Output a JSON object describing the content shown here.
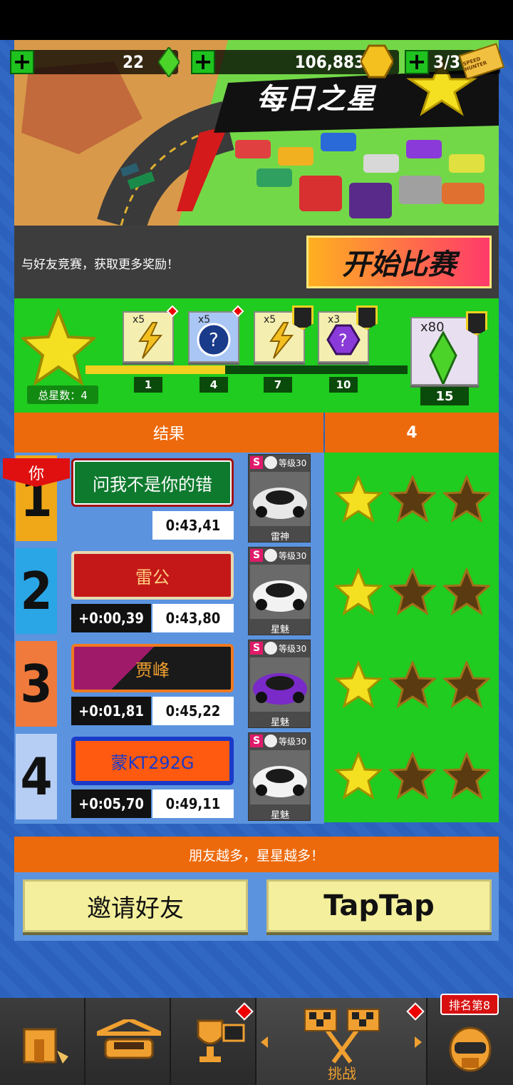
{
  "hud": {
    "gems": "22",
    "coins": "106,883",
    "tickets": "3/3",
    "ticket_badge": "SPEED HUNTER"
  },
  "banner": {
    "title": "每日之星"
  },
  "invite_strip": {
    "text": "与好友竞赛，获取更多奖励！",
    "start_button": "开始比赛"
  },
  "progress": {
    "total_stars_label": "总星数：4",
    "current_stars": 4,
    "rewards": [
      {
        "qty": "x5",
        "item": "lightning-icon",
        "milestone": "1",
        "locked": false,
        "new": true
      },
      {
        "qty": "x5",
        "item": "mystery-token-icon",
        "milestone": "4",
        "locked": false,
        "new": true
      },
      {
        "qty": "x5",
        "item": "lightning-icon",
        "milestone": "7",
        "locked": true,
        "new": false
      },
      {
        "qty": "x3",
        "item": "mystery-gem-icon",
        "milestone": "10",
        "locked": true,
        "new": false
      },
      {
        "qty": "x80",
        "item": "green-gem-icon",
        "milestone": "15",
        "locked": true,
        "new": false
      }
    ]
  },
  "results": {
    "header": "结果",
    "stars_header": "4",
    "you_tag": "你",
    "rows": [
      {
        "rank": "1",
        "name": "问我不是你的错",
        "diff": "",
        "time": "0:43,41",
        "car": "雷神",
        "level": "等级30",
        "stars": 1,
        "rank_color": "#f0a818",
        "plate": "green"
      },
      {
        "rank": "2",
        "name": "雷公",
        "diff": "+0:00,39",
        "time": "0:43,80",
        "car": "星魅",
        "level": "等级30",
        "stars": 1,
        "rank_color": "#2aa6e6",
        "plate": "red"
      },
      {
        "rank": "3",
        "name": "贾峰",
        "diff": "+0:01,81",
        "time": "0:45,22",
        "car": "星魅",
        "level": "等级30",
        "stars": 1,
        "rank_color": "#f07a3c",
        "plate": "dark"
      },
      {
        "rank": "4",
        "name": "蒙KT292G",
        "diff": "+0:05,70",
        "time": "0:49,11",
        "car": "星魅",
        "level": "等级30",
        "stars": 1,
        "rank_color": "#b6cdf4",
        "plate": "blue"
      }
    ]
  },
  "friends": {
    "banner": "朋友越多，星星越多！",
    "invite_button": "邀请好友",
    "taptap_button": "TapTap"
  },
  "nav": {
    "challenge_label": "挑战",
    "rank_badge": "排名第8"
  },
  "colors": {
    "accent_orange": "#ed6a0c",
    "panel_green": "#1fcc1f",
    "background_blue": "#2b5fb8"
  }
}
